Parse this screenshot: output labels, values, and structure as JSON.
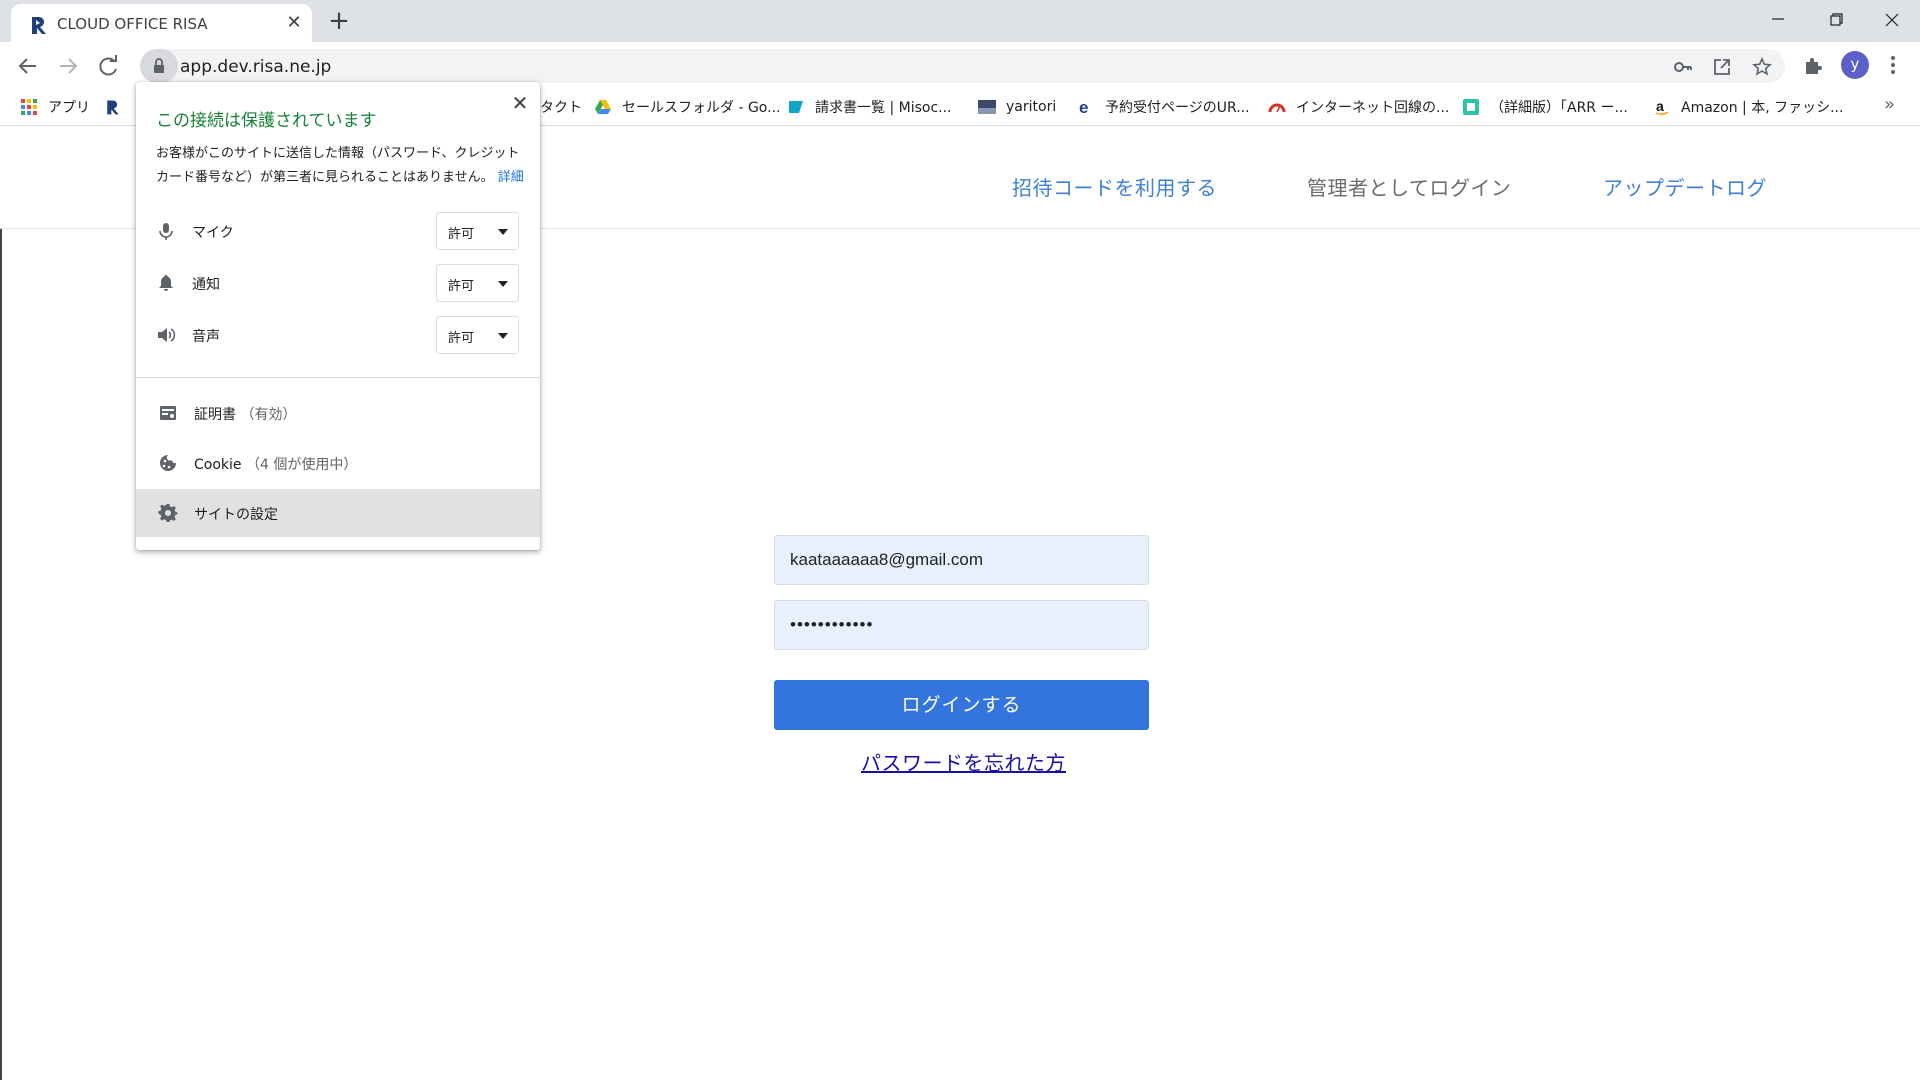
{
  "browser": {
    "tab": {
      "title": "CLOUD OFFICE RISA",
      "close_glyph": "✕"
    },
    "new_tab_glyph": "+",
    "url": "app.dev.risa.ne.jp",
    "profile_initial": "y",
    "bookmarks_overflow": "»",
    "bookmarks": [
      {
        "label": "アプリ",
        "icon": "apps-grid-icon"
      },
      {
        "label": "",
        "icon": "risa-logo-icon"
      },
      {
        "label": "タクト",
        "icon": ""
      },
      {
        "label": "セールスフォルダ - Go...",
        "icon": "google-drive-icon"
      },
      {
        "label": "請求書一覧 | Misoc...",
        "icon": "misoca-icon"
      },
      {
        "label": "yaritori",
        "icon": "yaritori-icon"
      },
      {
        "label": "予約受付ページのUR...",
        "icon": "edge-e-icon"
      },
      {
        "label": "インターネット回線の...",
        "icon": "speedometer-icon"
      },
      {
        "label": "（詳細版）「ARR ー...",
        "icon": "teal-square-icon"
      },
      {
        "label": "Amazon | 本, ファッシ...",
        "icon": "amazon-icon"
      }
    ]
  },
  "site_info_popup": {
    "title": "この接続は保護されています",
    "description": "お客様がこのサイトに送信した情報（パスワード、クレジット カード番号など）が第三者に見られることはありません。",
    "details_link": "詳細",
    "close_glyph": "✕",
    "permissions": [
      {
        "label": "マイク",
        "value": "許可",
        "icon": "microphone-icon"
      },
      {
        "label": "通知",
        "value": "許可",
        "icon": "bell-icon"
      },
      {
        "label": "音声",
        "value": "許可",
        "icon": "speaker-icon"
      }
    ],
    "certificate": {
      "label": "証明書",
      "status": "（有効）"
    },
    "cookie": {
      "label": "Cookie",
      "status": "（4 個が使用中）"
    },
    "site_settings": {
      "label": "サイトの設定"
    }
  },
  "header": {
    "invite_code": "招待コードを利用する",
    "admin_login": "管理者としてログイン",
    "update_log": "アップデートログ"
  },
  "login": {
    "email_value": "kaataaaaaa8@gmail.com",
    "password_mask": "••••••••••••",
    "submit_label": "ログインする",
    "forgot_label": "パスワードを忘れた方"
  },
  "colors": {
    "accent_blue": "#3375dc",
    "secure_green": "#188038",
    "autofill_bg": "#e8f0fe",
    "link_blue": "#3e7fd6"
  }
}
